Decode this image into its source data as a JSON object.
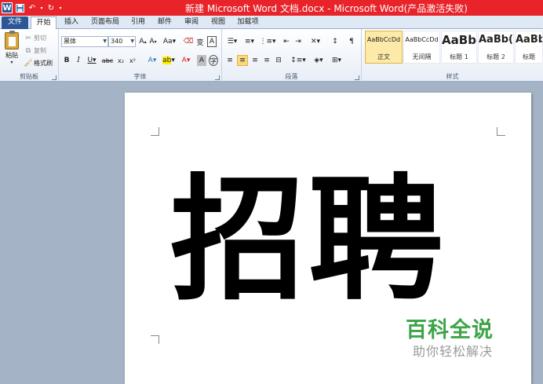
{
  "window": {
    "title": "新建 Microsoft Word 文档.docx - Microsoft Word(产品激活失败)"
  },
  "quick_access": {
    "app_logo": "W",
    "save_icon": "floppy-icon",
    "undo_icon": "undo-icon",
    "redo_icon": "redo-icon"
  },
  "tabs": [
    {
      "label": "文件"
    },
    {
      "label": "开始"
    },
    {
      "label": "插入"
    },
    {
      "label": "页面布局"
    },
    {
      "label": "引用"
    },
    {
      "label": "邮件"
    },
    {
      "label": "审阅"
    },
    {
      "label": "视图"
    },
    {
      "label": "加载项"
    }
  ],
  "ribbon": {
    "clipboard": {
      "group_label": "剪贴板",
      "paste": "粘贴",
      "cut": "剪切",
      "copy": "复制",
      "format_painter": "格式刷"
    },
    "font": {
      "group_label": "字体",
      "font_name": "黑体",
      "font_size": "340"
    },
    "paragraph": {
      "group_label": "段落"
    },
    "styles": {
      "group_label": "样式",
      "items": [
        {
          "sample": "AaBbCcDd",
          "name": "正文"
        },
        {
          "sample": "AaBbCcDd",
          "name": "无间隔"
        },
        {
          "sample": "AaBb",
          "name": "标题 1"
        },
        {
          "sample": "AaBb(",
          "name": "标题 2"
        },
        {
          "sample": "AaBb",
          "name": "标题"
        }
      ]
    }
  },
  "document": {
    "body_text": "招聘"
  },
  "watermark": {
    "title": "百科全说",
    "subtitle": "助你轻松解决"
  },
  "colors": {
    "title_bar": "#e8232a",
    "file_tab": "#2b5797",
    "watermark_green": "#3da448"
  }
}
